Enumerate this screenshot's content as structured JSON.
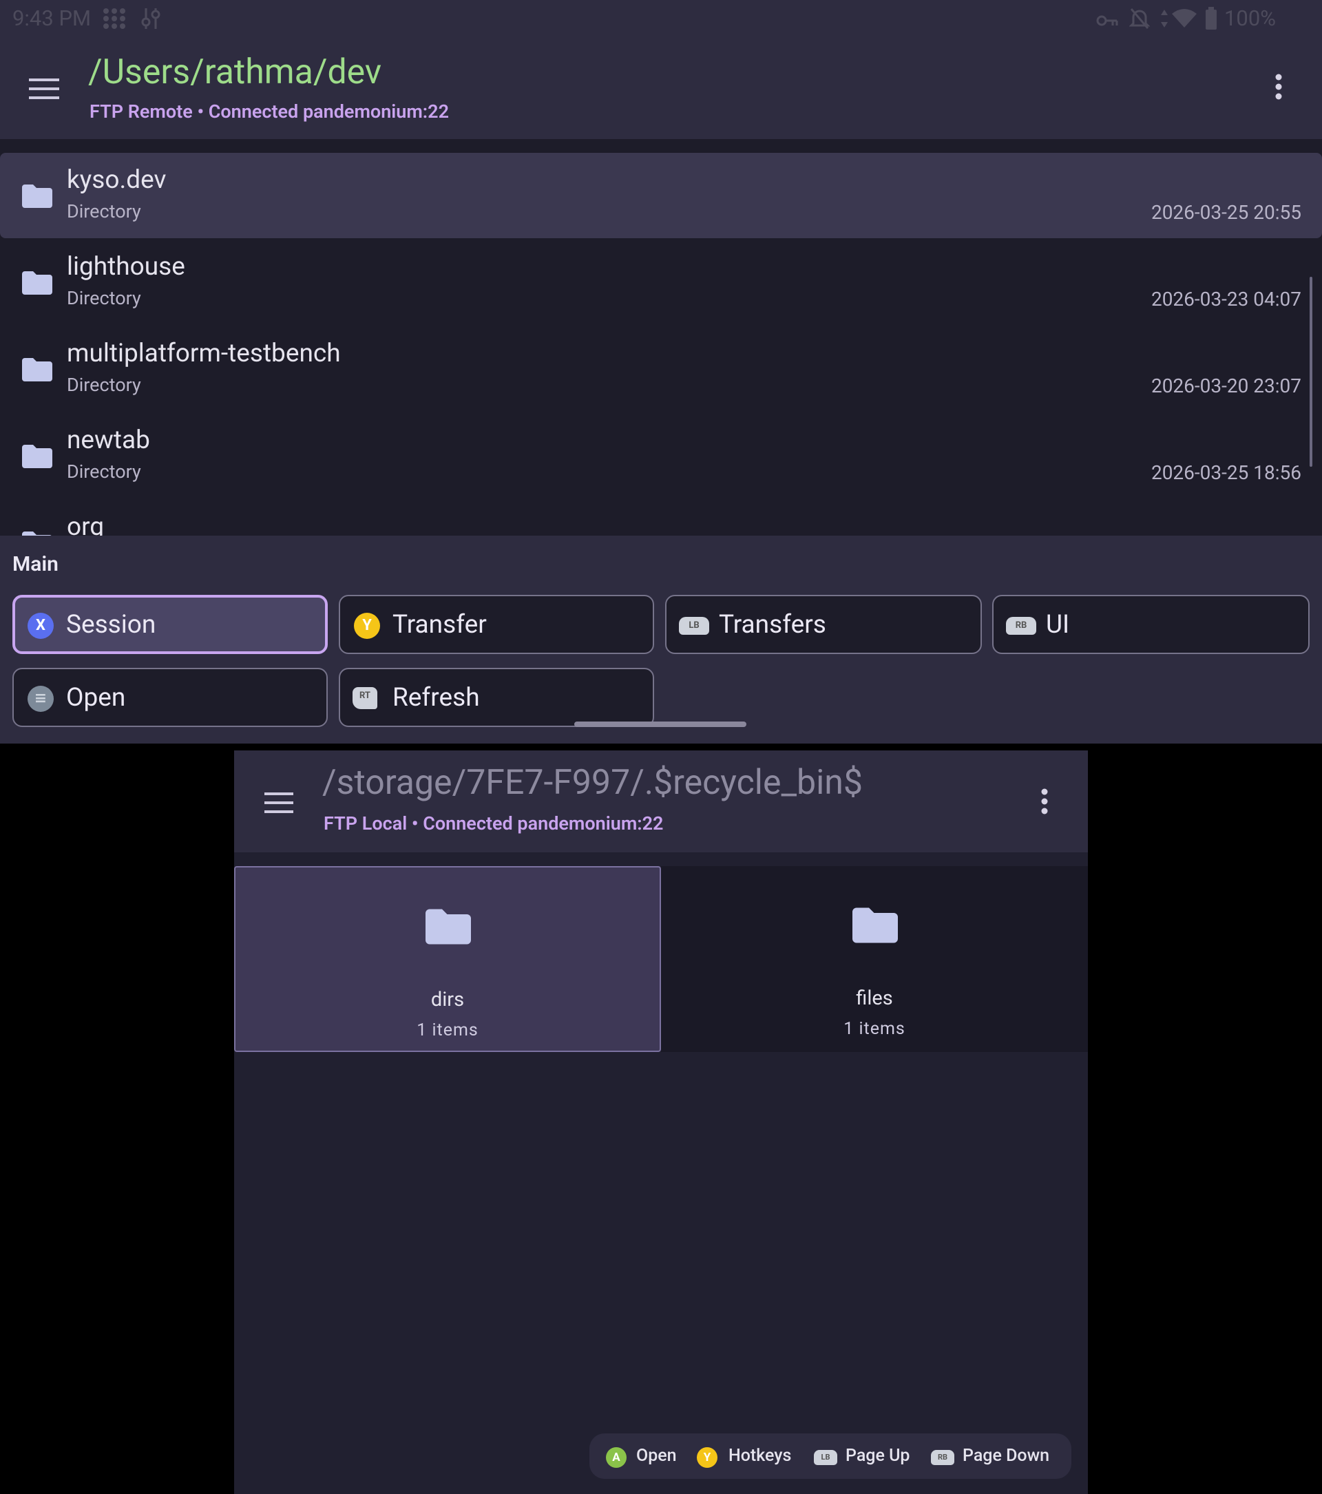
{
  "status_bar": {
    "time": "9:43 PM",
    "battery": "100%"
  },
  "remote": {
    "path": "/Users/rathma/dev",
    "subtitle": "FTP Remote • Connected pandemonium:22",
    "entries": [
      {
        "name": "kyso.dev",
        "type": "Directory",
        "date": "2026-03-25 20:55"
      },
      {
        "name": "lighthouse",
        "type": "Directory",
        "date": "2026-03-23 04:07"
      },
      {
        "name": "multiplatform-testbench",
        "type": "Directory",
        "date": "2026-03-20 23:07"
      },
      {
        "name": "newtab",
        "type": "Directory",
        "date": "2026-03-25 18:56"
      },
      {
        "name": "org",
        "type": "",
        "date": ""
      }
    ]
  },
  "sheet": {
    "title": "Main",
    "actions": [
      {
        "label": "Session",
        "button": "X"
      },
      {
        "label": "Transfer",
        "button": "Y"
      },
      {
        "label": "Transfers",
        "button": "LB"
      },
      {
        "label": "UI",
        "button": "RB"
      },
      {
        "label": "Open",
        "button": "≡"
      },
      {
        "label": "Refresh",
        "button": "RT"
      }
    ]
  },
  "local": {
    "path": "/storage/7FE7-F997/.$recycle_bin$",
    "subtitle": "FTP Local • Connected pandemonium:22",
    "tiles": [
      {
        "name": "dirs",
        "count": "1 items"
      },
      {
        "name": "files",
        "count": "1 items"
      }
    ]
  },
  "hints": [
    {
      "button": "A",
      "label": "Open"
    },
    {
      "button": "Y",
      "label": "Hotkeys"
    },
    {
      "button": "LB",
      "label": "Page Up"
    },
    {
      "button": "RB",
      "label": "Page Down"
    }
  ],
  "colors": {
    "path_green": "#9edc8a",
    "subtitle_purple": "#c9a3ee",
    "selection": "#3b3850",
    "accent_border": "#c8a6f0"
  }
}
